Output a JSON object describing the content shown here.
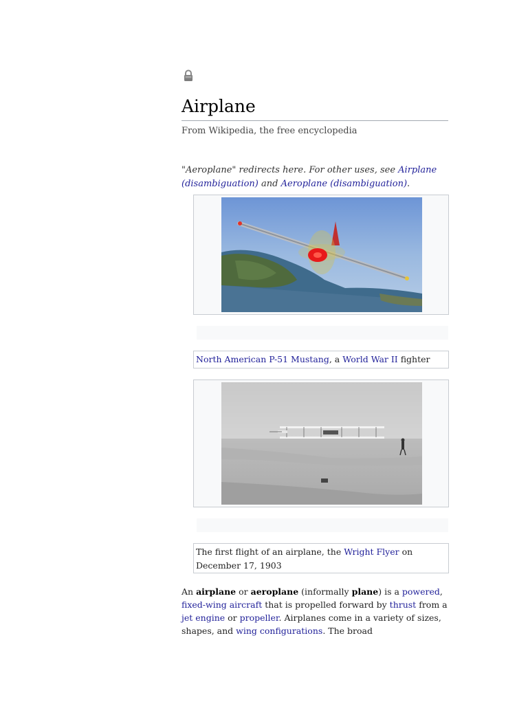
{
  "article": {
    "title": "Airplane",
    "tagline": "From Wikipedia, the free encyclopedia"
  },
  "hatnote": {
    "prefix": "\"Aeroplane\" redirects here. For other uses, see ",
    "link1": "Airplane (disambiguation)",
    "middle": " and ",
    "link2": "Aeroplane (disambiguation)",
    "suffix": "."
  },
  "figures": [
    {
      "caption_link1": "North American P-51 Mustang",
      "caption_mid": ", a ",
      "caption_link2": "World War II",
      "caption_suffix": " fighter"
    },
    {
      "caption_prefix": "The first flight of an airplane, the ",
      "caption_link": "Wright Flyer",
      "caption_suffix": " on December 17, 1903"
    }
  ],
  "intro": {
    "t1": "An ",
    "b1": "airplane",
    "t2": " or ",
    "b2": "aeroplane",
    "t3": " (informally ",
    "b3": "plane",
    "t4": ") is a ",
    "l1": "powered",
    "t5": ", ",
    "l2": "fixed-wing aircraft",
    "t6": " that is propelled forward by ",
    "l3": "thrust",
    "t7": " from a ",
    "l4": "jet engine",
    "t8": " or ",
    "l5": "propeller",
    "t9": ". Airplanes come in a variety of sizes, shapes, and ",
    "l6": "wing configurations",
    "t10": ". The broad"
  },
  "colors": {
    "link": "#22229a",
    "border": "#c8ccd1"
  },
  "icons": {
    "lock": "padlock-icon"
  }
}
